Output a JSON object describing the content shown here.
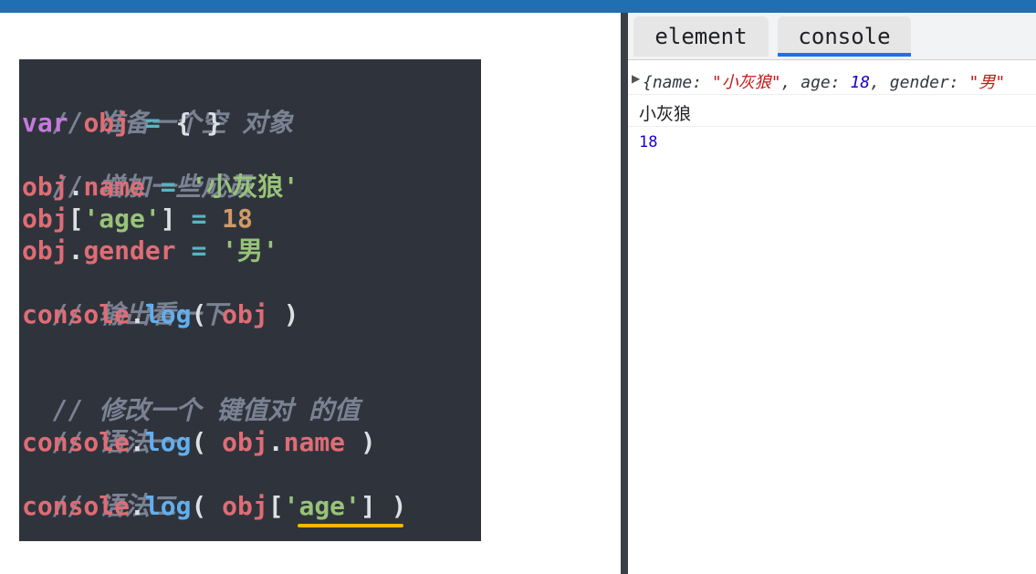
{
  "colors": {
    "topbar": "#1f6fb2",
    "code_bg": "#2f343c",
    "highlight_underline": "#f2b705",
    "tab_active_indicator": "#1a73e8"
  },
  "code": {
    "line1_comment": "// 准备一个空 对象",
    "line2": {
      "var": "var",
      "obj": "obj",
      "eq": "=",
      "braces": "{ }"
    },
    "line3_comment": "// 增加一些成员",
    "line4": {
      "obj": "obj",
      "dot": ".",
      "prop": "name",
      "eq": "=",
      "value": "'小灰狼'"
    },
    "line5": {
      "obj": "obj",
      "open": "[",
      "key": "'age'",
      "close": "]",
      "eq": "=",
      "value": "18"
    },
    "line6": {
      "obj": "obj",
      "dot": ".",
      "prop": "gender",
      "eq": "=",
      "value": "'男'"
    },
    "line7_comment": "// 输出看一下",
    "line8": {
      "console": "console",
      "dot": ".",
      "log": "log",
      "open": "(",
      "arg": "obj",
      "close": ")"
    },
    "line10_comment": "// 修改一个 键值对 的值",
    "line11_comment": "// 语法一",
    "line12": {
      "console": "console",
      "dot": ".",
      "log": "log",
      "open": "(",
      "obj": "obj",
      "dot2": ".",
      "prop": "name",
      "close": ")"
    },
    "line13_comment": "// 语法二",
    "line14": {
      "console": "console",
      "dot": ".",
      "log": "log",
      "open": "(",
      "obj": "obj",
      "bopen": "[",
      "key": "'age'",
      "bclose": "]",
      "close": ")"
    }
  },
  "devtools": {
    "tabs": [
      {
        "label": "element"
      },
      {
        "label": "console"
      }
    ],
    "active_tab": "console",
    "logs": {
      "object_preview": {
        "name_key": "name: ",
        "name_value": "\"小灰狼\"",
        "age_key": ", age: ",
        "age_value": "18",
        "gender_key": ", gender: ",
        "gender_value": "\"男\""
      },
      "line2": "小灰狼",
      "line3": "18"
    }
  }
}
